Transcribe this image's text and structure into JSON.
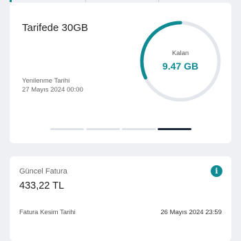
{
  "usage_card": {
    "title": "Tarifede 30GB",
    "renewal_label": "Yenilenme Tarihi",
    "renewal_date": "27 Mayıs 2024 00:00",
    "remaining_label": "Kalan",
    "remaining_value": "9.47 GB",
    "remaining_fraction": 0.32,
    "gauge_color": "#0d8a93",
    "track_color": "#e3e6ea",
    "pager": {
      "count": 4,
      "active_index": 3
    }
  },
  "invoice_card": {
    "label": "Güncel Fatura",
    "amount": "433,22 TL",
    "info_icon": "info-icon",
    "cut_label": "Fatura Kesim Tarihi",
    "cut_date": "26 Mayıs 2024 23:59"
  },
  "colors": {
    "accent": "#0d8a93",
    "background": "#eef0f3"
  }
}
